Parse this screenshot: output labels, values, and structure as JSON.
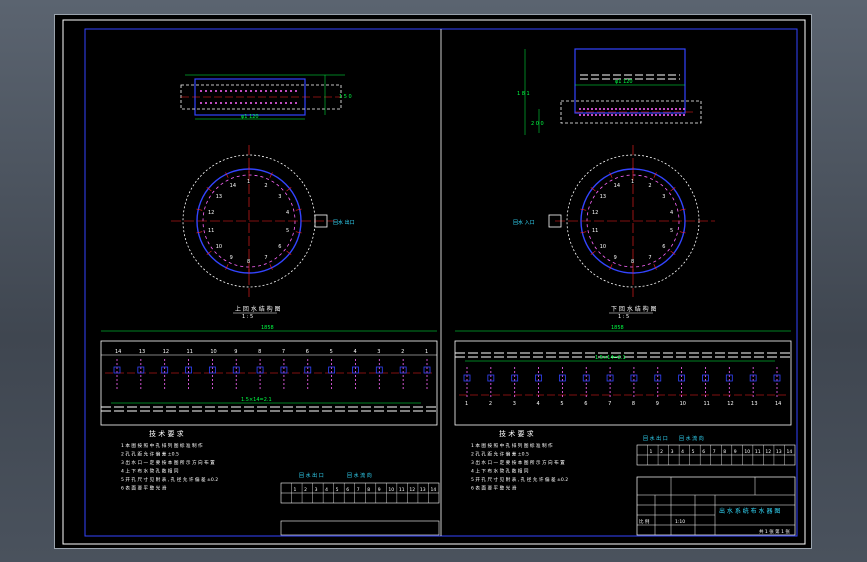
{
  "title_left": "上 回 水 结 构 图",
  "title_right": "下 回 水 结 构 图",
  "scale": "1 : 5",
  "label_water_out": "回水 出口",
  "label_water_in": "回水 入口",
  "dim_top_width": "1858",
  "dim_len_left": "1.5×14=2.1",
  "dim_len_right": "1.5×14=2.1",
  "dim_top_diam": "φ1 120",
  "dim_height_right": "1 8 1",
  "dim_side_left": "1 5 0",
  "dim_right_bot": "2 0 0",
  "tech_title": "技 术 要 求",
  "tech_notes": [
    "1 本 图 按 照 中 孔 排 列 图 标 准 制 作",
    "2 孔 孔 距 允 许 偏 差 ±0.5",
    "3 出 水 口 一 定 要 按 本 图 所 示 方 向 布 置",
    "4 上 下 布 水 管 孔 数 相 同",
    "5 开 孔 尺 寸 见 附 表 , 孔 径 允 许 偏 差 ±0.2",
    "6 表 面 要 平 整 光 滑"
  ],
  "table_header_left": "回 水 出 口",
  "table_header_right": "回 水 流 向",
  "table_numbers": [
    "1",
    "2",
    "3",
    "4",
    "5",
    "6",
    "7",
    "8",
    "9",
    "10",
    "11",
    "12",
    "13",
    "14"
  ],
  "pipe_labels_left": [
    "14",
    "13",
    "12",
    "11",
    "10",
    "9",
    "8",
    "7",
    "6",
    "5",
    "4",
    "3",
    "2",
    "1"
  ],
  "circle_numbers": [
    "1",
    "2",
    "3",
    "4",
    "5",
    "6",
    "7",
    "8",
    "9",
    "10",
    "11",
    "12",
    "13",
    "14"
  ],
  "title_block": {
    "drawing_name": "出 水 系 统 布 水 器 图",
    "scale_label": "比 例",
    "scale_value": "1:10",
    "sheet": "共 1 张 第 1 张"
  },
  "colors": {
    "frame": "#ffffff",
    "border": "#3344ff",
    "dimension": "#00ff44",
    "center": "#ff2222",
    "annotation": "#33ddff",
    "pipe": "#ff66ff"
  }
}
